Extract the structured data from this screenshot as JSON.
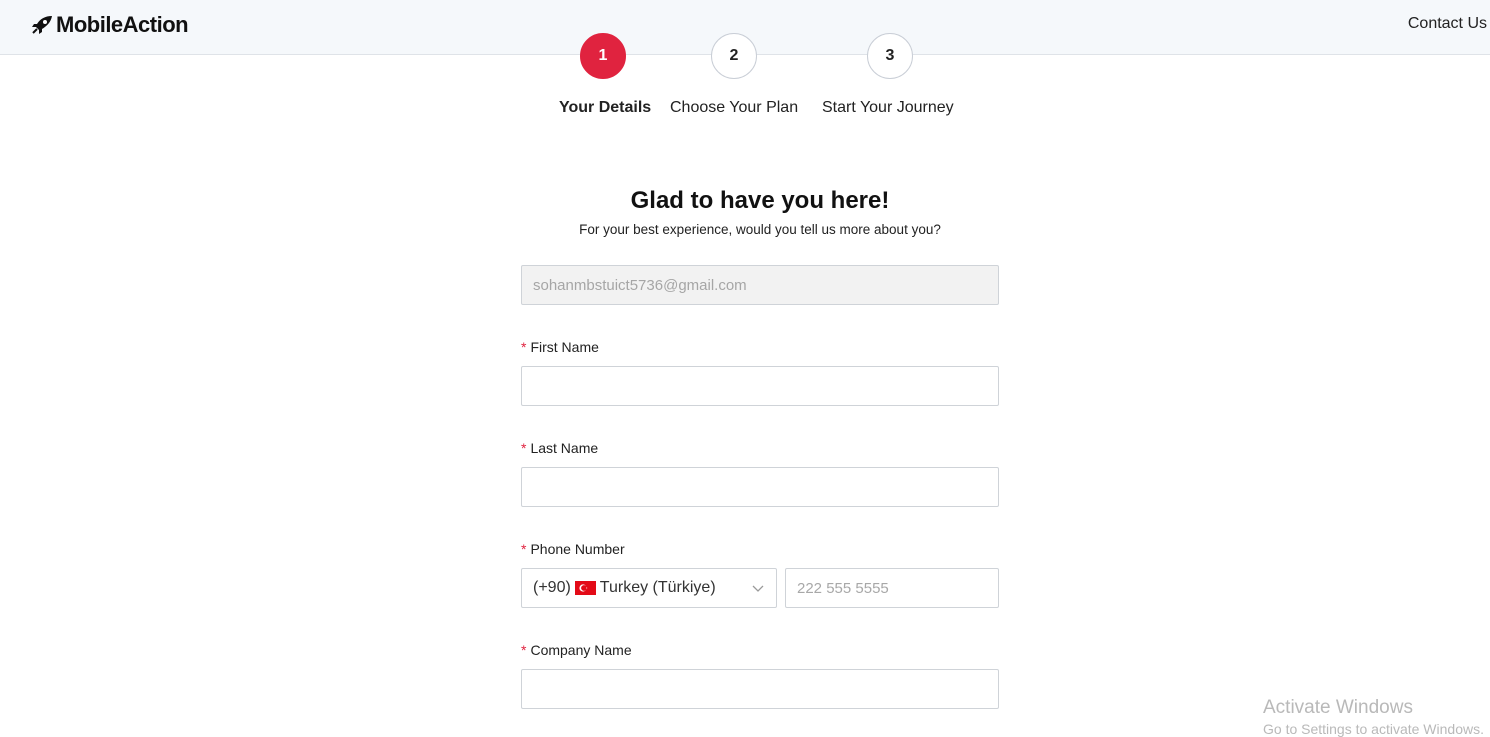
{
  "header": {
    "brand": "MobileAction",
    "contact_label": "Contact Us"
  },
  "steps": [
    {
      "number": "1",
      "label": "Your Details",
      "active": true
    },
    {
      "number": "2",
      "label": "Choose Your Plan",
      "active": false
    },
    {
      "number": "3",
      "label": "Start Your Journey",
      "active": false
    }
  ],
  "form": {
    "title": "Glad to have you here!",
    "subtitle": "For your best experience, would you tell us more about you?",
    "email_value": "sohanmbstuict5736@gmail.com",
    "required_mark": "*",
    "first_name_label": "First Name",
    "last_name_label": "Last Name",
    "phone_label": "Phone Number",
    "phone_code": "(+90)",
    "phone_country": "Turkey (Türkiye)",
    "phone_placeholder": "222 555 5555",
    "company_label": "Company Name"
  },
  "watermark": {
    "title": "Activate Windows",
    "subtitle": "Go to Settings to activate Windows."
  },
  "colors": {
    "accent": "#e0233f",
    "header_bg": "#f5f8fb"
  },
  "icons": {
    "logo": "rocket-icon",
    "dropdown": "chevron-down-icon",
    "flag": "turkey-flag-icon"
  }
}
